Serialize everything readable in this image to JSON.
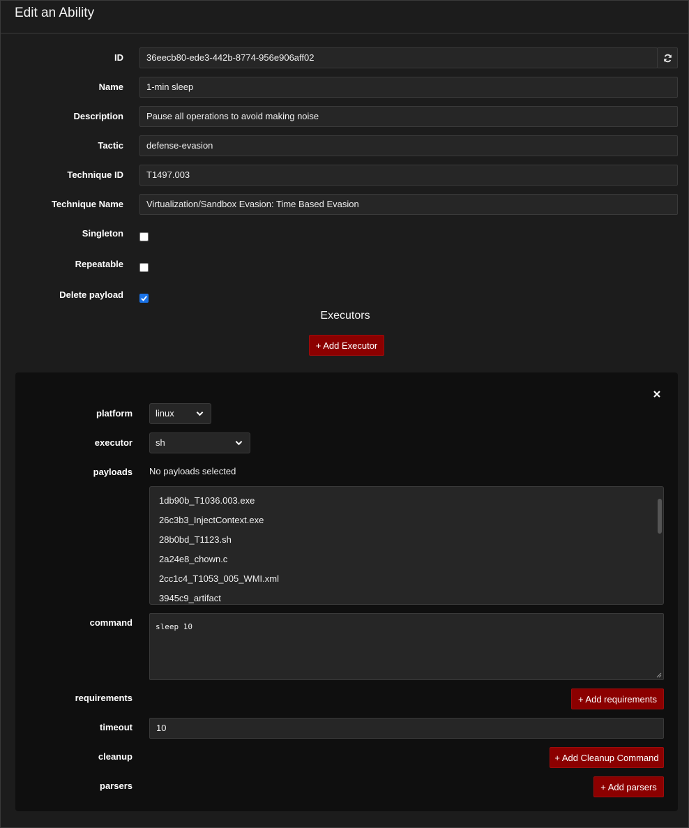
{
  "header": {
    "title": "Edit an Ability"
  },
  "fields": {
    "id": {
      "label": "ID",
      "value": "36eecb80-ede3-442b-8774-956e906aff02"
    },
    "name": {
      "label": "Name",
      "value": "1-min sleep"
    },
    "description": {
      "label": "Description",
      "value": "Pause all operations to avoid making noise"
    },
    "tactic": {
      "label": "Tactic",
      "value": "defense-evasion"
    },
    "technique_id": {
      "label": "Technique ID",
      "value": "T1497.003"
    },
    "technique_name": {
      "label": "Technique Name",
      "value": "Virtualization/Sandbox Evasion: Time Based Evasion"
    },
    "singleton": {
      "label": "Singleton",
      "checked": false
    },
    "repeatable": {
      "label": "Repeatable",
      "checked": false
    },
    "delete_payload": {
      "label": "Delete payload",
      "checked": true
    }
  },
  "icons": {
    "refresh": "refresh-icon",
    "close": "close-icon",
    "chevron": "chevron-down-icon"
  },
  "executors": {
    "title": "Executors",
    "add_button": "+ Add Executor",
    "item": {
      "platform": {
        "label": "platform",
        "value": "linux"
      },
      "executor": {
        "label": "executor",
        "value": "sh"
      },
      "payloads": {
        "label": "payloads",
        "status": "No payloads selected",
        "options": [
          "1db90b_T1036.003.exe",
          "26c3b3_InjectContext.exe",
          "28b0bd_T1123.sh",
          "2a24e8_chown.c",
          "2cc1c4_T1053_005_WMI.xml",
          "3945c9_artifact"
        ]
      },
      "command": {
        "label": "command",
        "value": "sleep 10"
      },
      "requirements": {
        "label": "requirements",
        "button": "+ Add requirements"
      },
      "timeout": {
        "label": "timeout",
        "value": "10"
      },
      "cleanup": {
        "label": "cleanup",
        "button": "+ Add Cleanup Command"
      },
      "parsers": {
        "label": "parsers",
        "button": "+ Add parsers"
      }
    }
  },
  "colors": {
    "accent_red": "#8b0000",
    "checkbox_blue": "#1a73e8",
    "background": "#1c1c1c",
    "panel": "#0f0f0f"
  }
}
